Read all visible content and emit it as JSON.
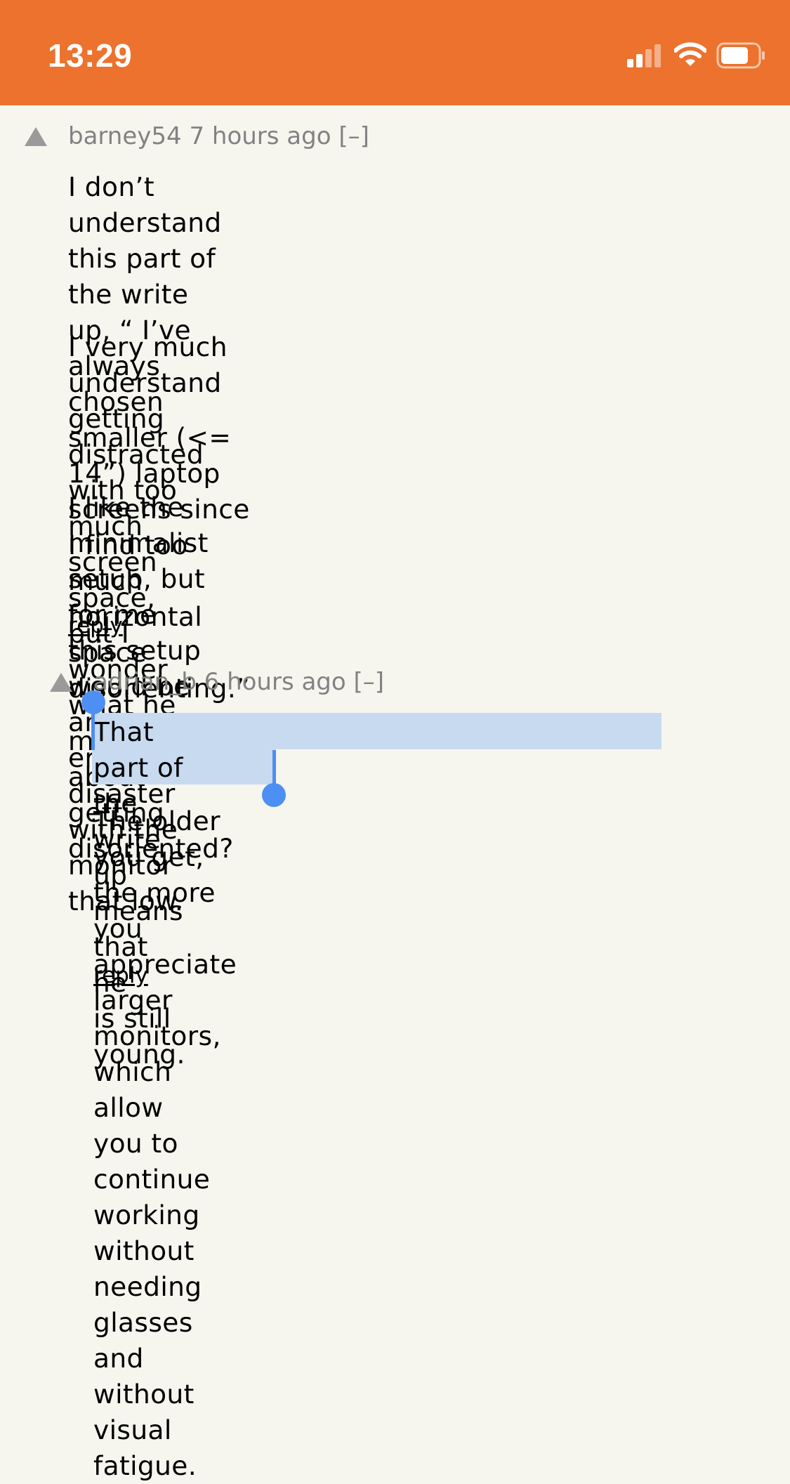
{
  "status_bar": {
    "time": "13:29",
    "signal_icon": "cellular-signal-icon",
    "wifi_icon": "wifi-icon",
    "battery_icon": "battery-icon",
    "background_color": "#ec722e"
  },
  "comments": [
    {
      "user": "barney54",
      "age": "7 hours ago",
      "toggle": "[–]",
      "paragraphs": [
        [
          "I don’t understand this part of the write",
          "up, “ I’ve always chosen smaller (<=",
          "14”) laptop screens since I find too",
          "much horizontal space disorienting.”"
        ],
        [
          "I very much understand getting",
          "distracted with too much screen space,",
          "but I wonder what he means about",
          "getting disoriented?"
        ],
        [
          "I like the minimalist setup, but for me",
          "this setup would be an ergonomic",
          "disaster with the monitor that low."
        ]
      ],
      "reply": "reply"
    },
    {
      "user": "adrian_b",
      "age": "6 hours ago",
      "toggle": "[–]",
      "paragraphs": [
        [
          "That part of the write up means that he",
          "is still young."
        ],
        [
          "The older you get, the more you",
          "appreciate larger monitors, which allow",
          "you to continue working without needing",
          "glasses and without visual fatigue."
        ]
      ],
      "reply": "reply",
      "selected_text": "That part of the write up means that he is still young."
    }
  ],
  "colors": {
    "page_background": "#f6f6ef",
    "meta_text": "#828282",
    "selection_highlight": "#c7daef",
    "selection_handle": "#4d8ff2"
  }
}
